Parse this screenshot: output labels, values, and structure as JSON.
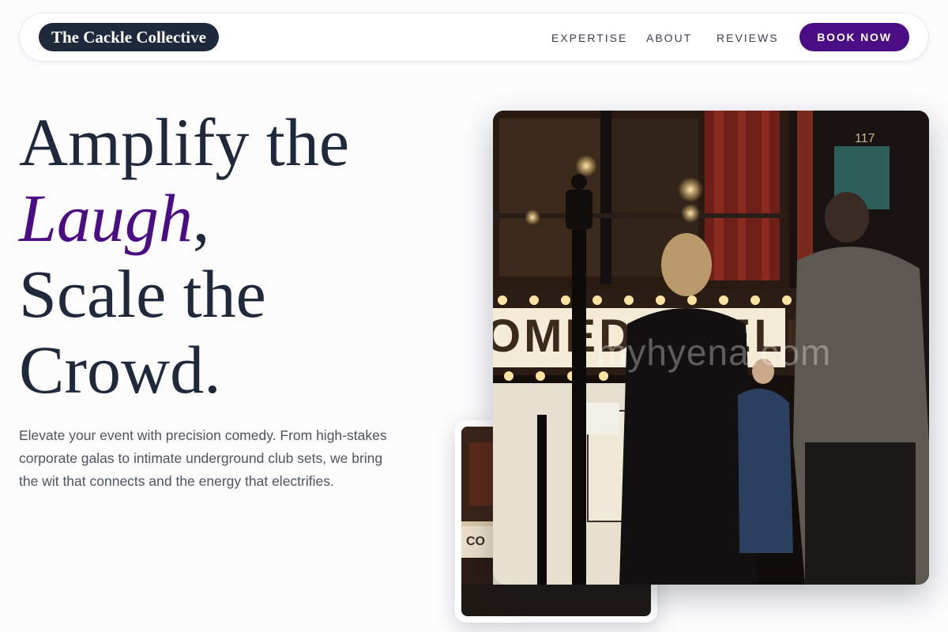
{
  "nav": {
    "brand": "The Cackle Collective",
    "links": [
      "EXPERTISE",
      "ABOUT",
      "REVIEWS"
    ],
    "cta": "BOOK NOW"
  },
  "hero": {
    "headline_line1": "Amplify the",
    "headline_accent": "Laugh",
    "headline_comma": ",",
    "headline_line3": "Scale the",
    "headline_line4": "Crowd.",
    "subtext": "Elevate your event with precision comedy. From high-stakes corporate galas to intimate underground club sets, we bring the wit that connects and the energy that electrifies."
  },
  "images": {
    "main_photo": "comedy-club-entrance-photo",
    "secondary_photo": "comedy-club-interior-photo",
    "watermark": "myhyena.com",
    "marquee_text": "COMEDY CELLAR"
  },
  "colors": {
    "accent": "#4a0d84",
    "navy": "#1e293b",
    "body_text": "#4b5563",
    "background": "#fcfcfd"
  }
}
